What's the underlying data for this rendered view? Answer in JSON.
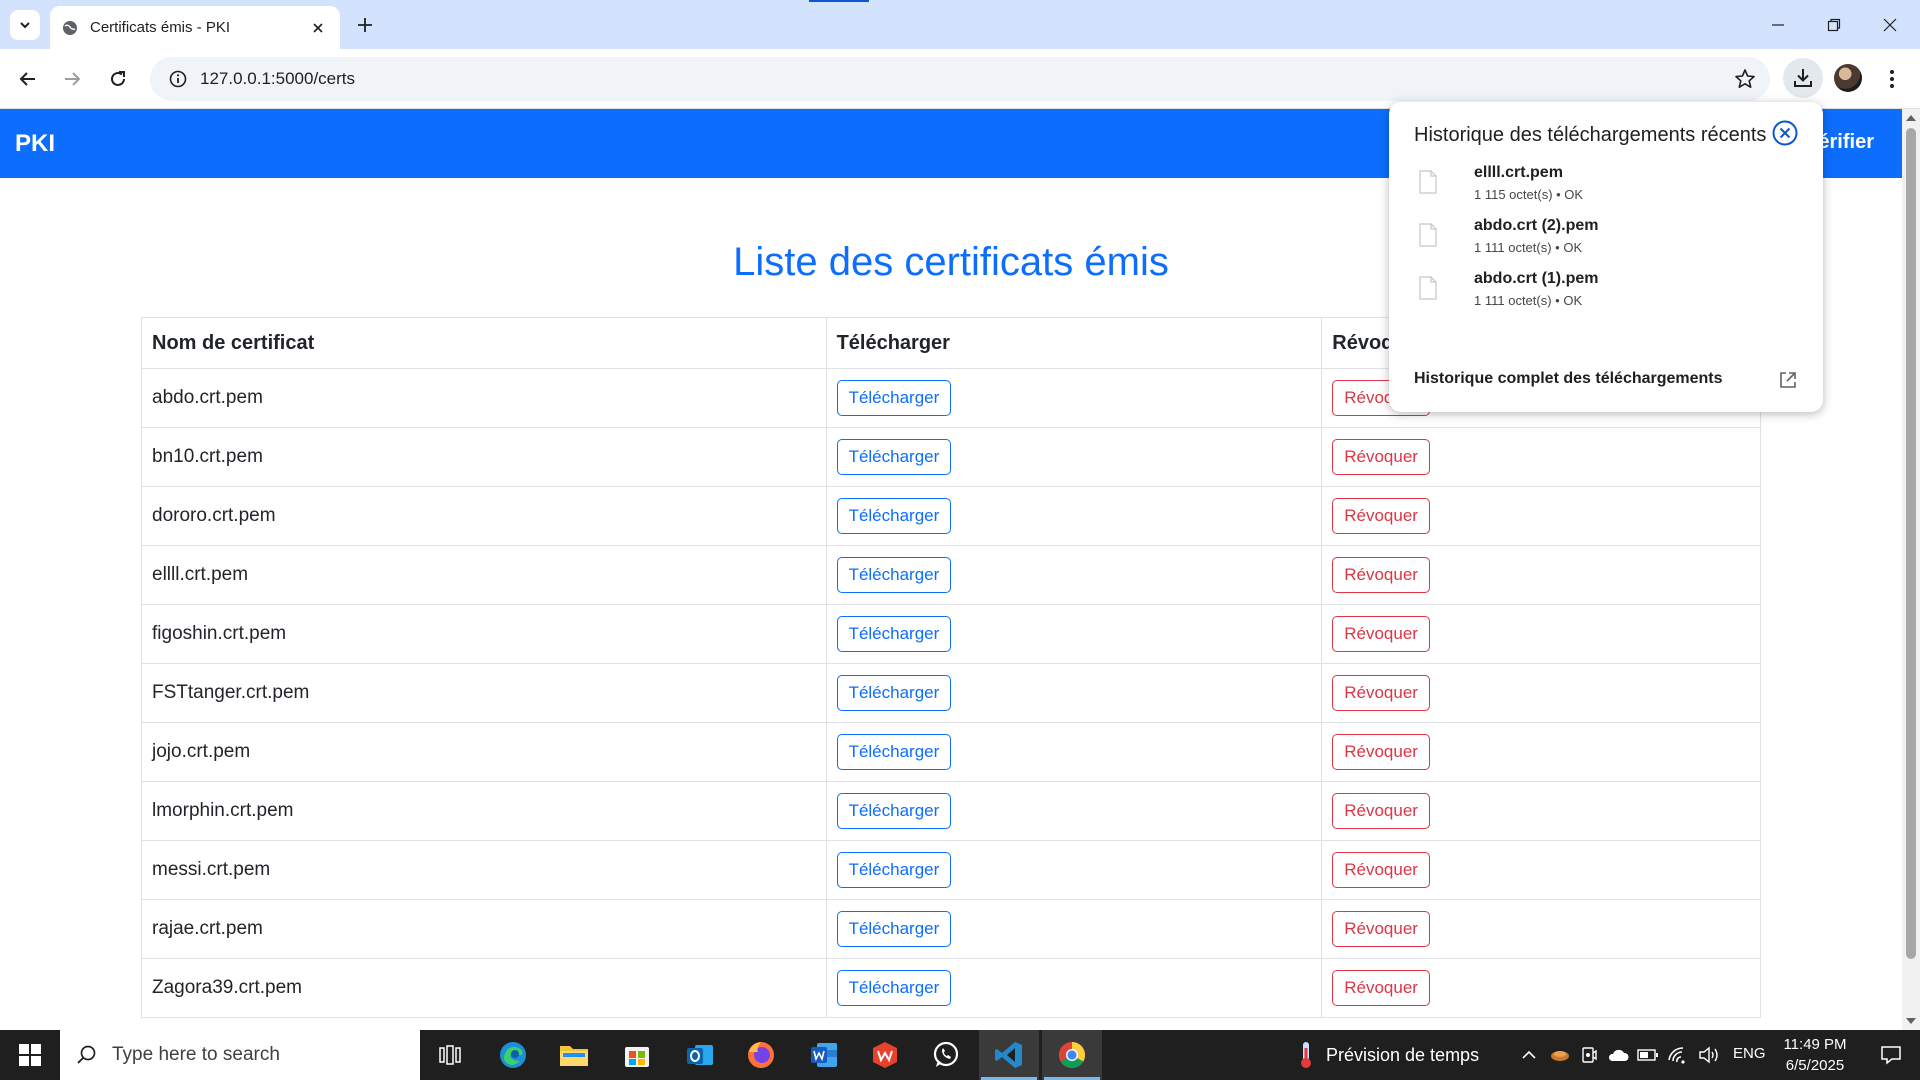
{
  "browser": {
    "tab_title": "Certificats émis - PKI",
    "url": "127.0.0.1:5000/certs"
  },
  "page": {
    "brand": "PKI",
    "nav_link": "Vérifier",
    "title": "Liste des certificats émis",
    "table": {
      "headers": [
        "Nom de certificat",
        "Télécharger",
        "Révoquer"
      ],
      "download_label": "Télécharger",
      "revoke_label": "Révoquer",
      "rows": [
        "abdo.crt.pem",
        "bn10.crt.pem",
        "dororo.crt.pem",
        "ellll.crt.pem",
        "figoshin.crt.pem",
        "FSTtanger.crt.pem",
        "jojo.crt.pem",
        "lmorphin.crt.pem",
        "messi.crt.pem",
        "rajae.crt.pem",
        "Zagora39.crt.pem"
      ]
    }
  },
  "downloads": {
    "header": "Historique des téléchargements récents",
    "items": [
      {
        "name": "ellll.crt.pem",
        "meta": "1 115 octet(s) • OK"
      },
      {
        "name": "abdo.crt (2).pem",
        "meta": "1 111 octet(s) • OK"
      },
      {
        "name": "abdo.crt (1).pem",
        "meta": "1 111 octet(s) • OK"
      }
    ],
    "footer": "Historique complet des téléchargements"
  },
  "taskbar": {
    "search_placeholder": "Type here to search",
    "weather": "Prévision de temps",
    "lang": "ENG",
    "time": "11:49 PM",
    "date": "6/5/2025",
    "apps": [
      "task-view",
      "edge",
      "file-explorer",
      "microsoft-store",
      "outlook",
      "firefox",
      "word",
      "wps-office",
      "whatsapp",
      "vscode",
      "chrome"
    ]
  },
  "colors": {
    "primary": "#0d6efd",
    "danger": "#dc3545",
    "tabstrip": "#d3e3fd",
    "taskbar": "#1f1f1f"
  }
}
